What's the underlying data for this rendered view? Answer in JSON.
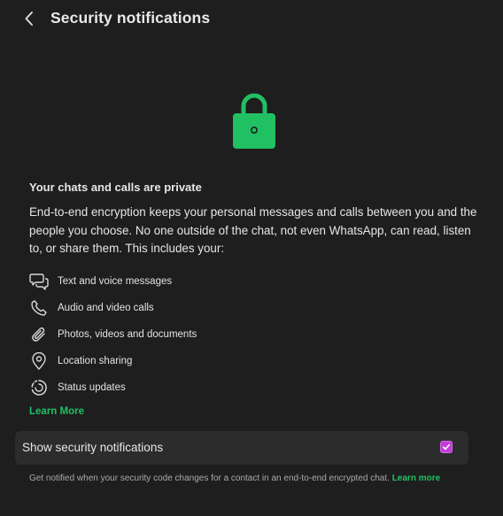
{
  "header": {
    "title": "Security notifications",
    "back_icon": "chevron-left-icon"
  },
  "hero": {
    "icon": "lock-icon",
    "accent_color": "#21c063"
  },
  "info": {
    "heading": "Your chats and calls are private",
    "description": "End-to-end encryption keeps your personal messages and calls between you and the people you choose. No one outside of the chat, not even WhatsApp, can read, listen to, or share them. This includes your:",
    "features": [
      {
        "icon": "chat-bubbles-icon",
        "label": "Text and voice messages"
      },
      {
        "icon": "phone-icon",
        "label": "Audio and video calls"
      },
      {
        "icon": "paperclip-icon",
        "label": "Photos, videos and documents"
      },
      {
        "icon": "location-pin-icon",
        "label": "Location sharing"
      },
      {
        "icon": "status-icon",
        "label": "Status updates"
      }
    ],
    "learn_more": "Learn More"
  },
  "setting": {
    "label": "Show security notifications",
    "checked": true,
    "checkbox_color": "#c13cd6",
    "footnote": "Get notified when your security code changes for a contact in an end-to-end encrypted chat.",
    "footnote_link": "Learn more"
  }
}
